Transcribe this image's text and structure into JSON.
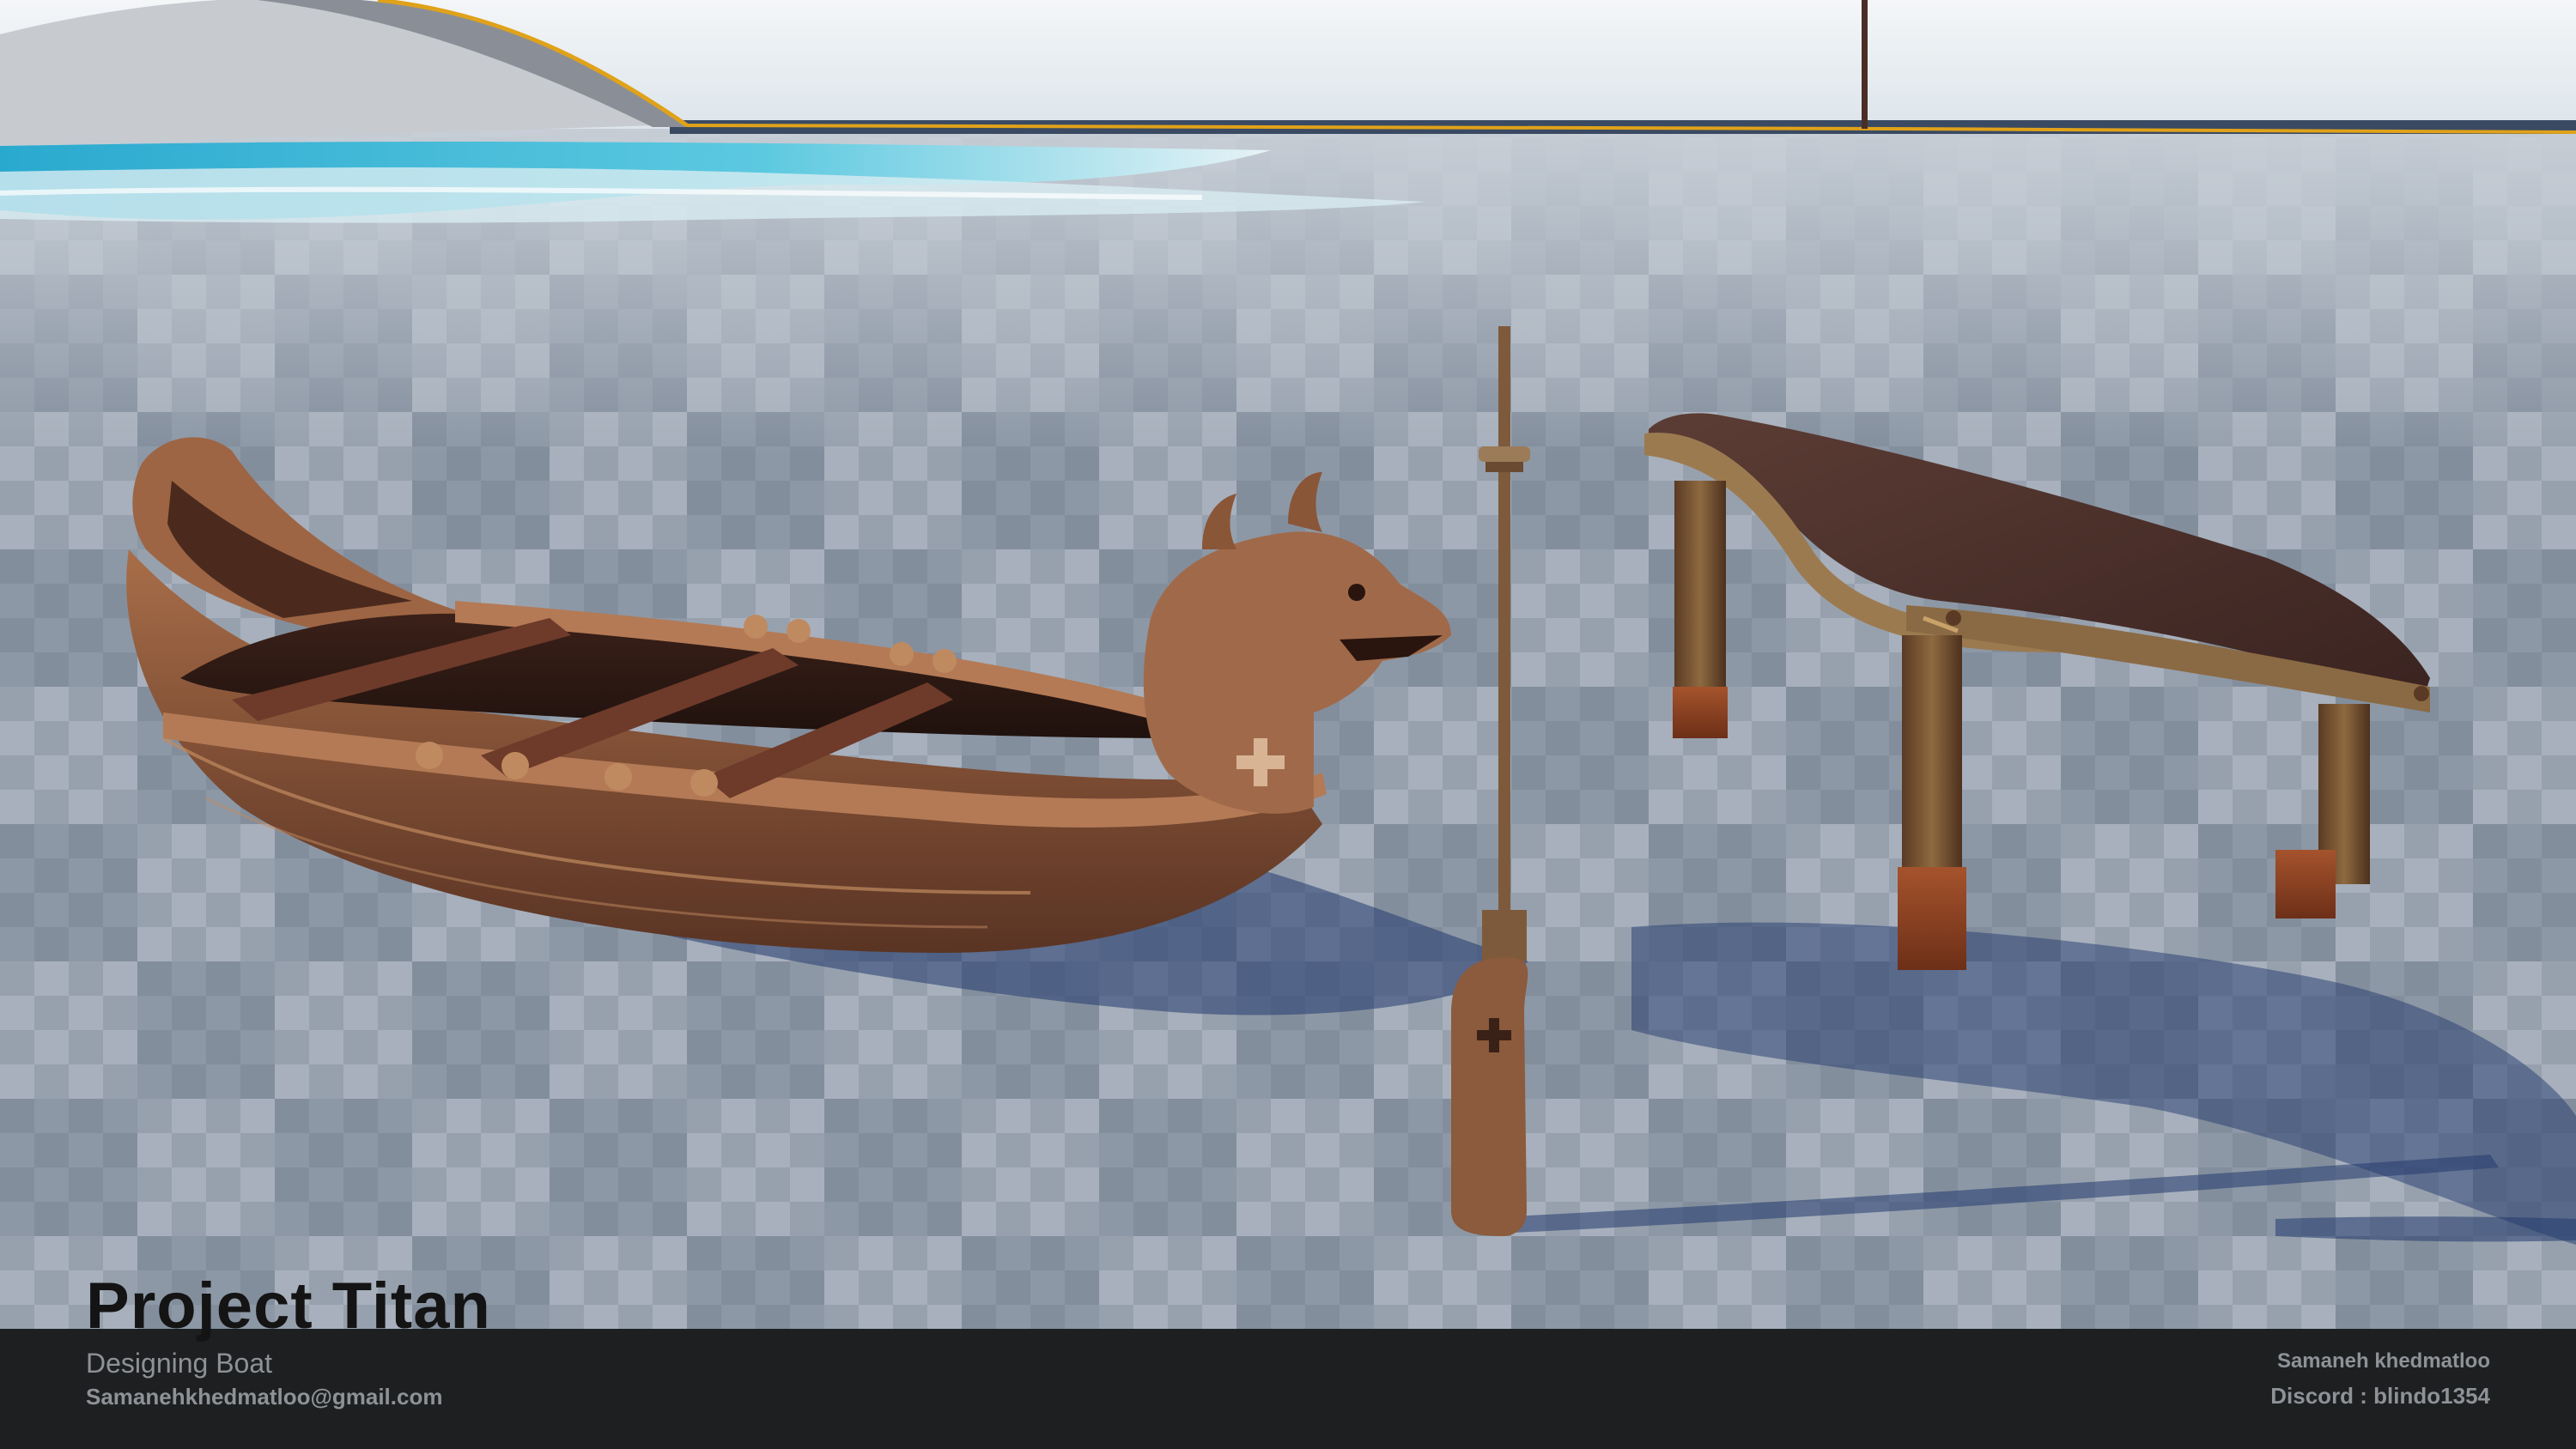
{
  "caption": {
    "project_title": "Project Titan",
    "subtitle": "Designing Boat",
    "email": "Samanehkhedmatloo@gmail.com",
    "author": "Samaneh khedmatloo",
    "discord": "Discord : blindo1354"
  },
  "colors": {
    "sky": "#e9eef2",
    "ground_light": "#a7b1bd",
    "ground_dark": "#7c8796",
    "water": "#2fb4d6",
    "wood": "#8a5638",
    "wood_dark": "#3a2118",
    "footer": "#1d1f21",
    "footer_text": "#8e9296",
    "horizon_accent": "#e0a21a"
  },
  "scene_objects": [
    "rowing-boat",
    "dragon-figurehead",
    "oar",
    "bench",
    "island-hill",
    "shoreline-water"
  ]
}
